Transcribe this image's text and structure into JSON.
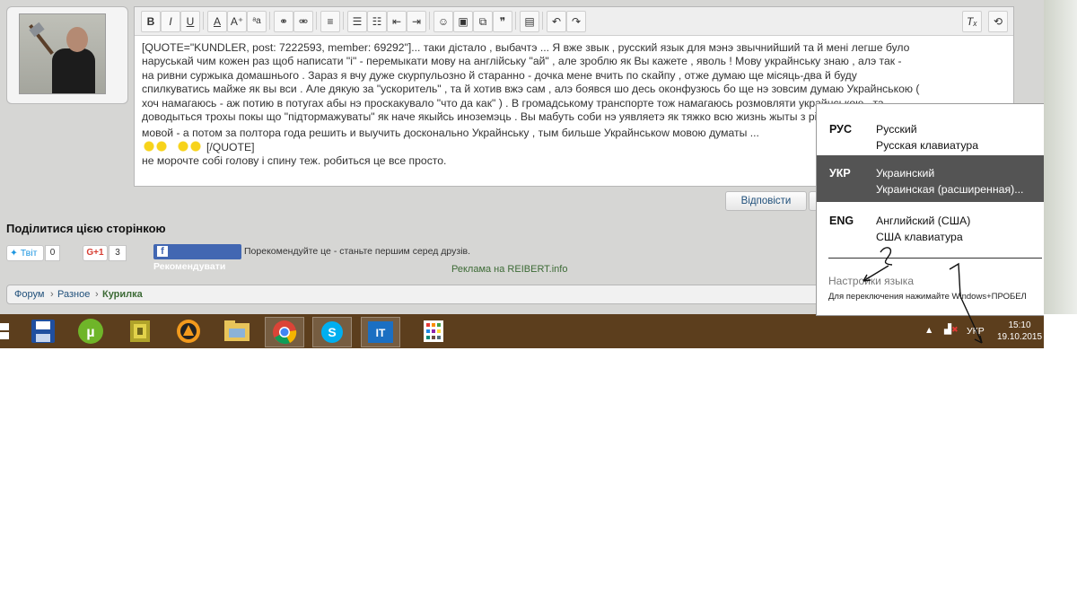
{
  "editor": {
    "lines": [
      "[QUOTE=\"KUNDLER, post: 7222593, member: 69292\"]... таки дістало , выбачтэ  ... Я вже звык , русский язык для мэнэ звычнийший  та й мені легше було",
      "наруськай чим кожен раз щоб написати  \"і\" - перемыкати мову на англійську \"ай\" , але зроблю як Вы кажете , яволь ! Мову украйнськy знаю , алэ так -",
      "на ривни суржыка домашнього .  Зараз я  вчу дуже скурпульозно й старанно - дочка мене вчить по скайпу , отже думаю ще місяць-два й буду",
      "спилкуватись майже як вы вси . Але дякую за \"ускоритель\" , та й хотив вжэ сам , алэ боявся шо десь оконфузюсь бо ще нэ зовсим думаю Украйнською (",
      "хоч намагаюсь - аж потию в потугах абы нэ проскакувало \"что да как\" ) . В громадському транспорте тож намагаюсь розмовляти украйнською , та",
      "доводыться трохы покы що \"підтормажуваты\"  як наче якыйсь иноземэць . Вы мабуть соби нэ уявляетэ як тяжко всю жизнь жыты з рiдною росийськой",
      "мовой - а потом за полтора года решить и выучить досконально Украйнську , тым бильше Украйнськow мовою думаты ..."
    ],
    "quote_end": "[/QUOTE]",
    "reply_line": "не морочте собі голову і спину теж. робиться це все просто."
  },
  "buttons": {
    "reply": "Відповісти"
  },
  "share": {
    "title": "Поділитися цією сторінкою",
    "tweet": "Твіт",
    "tweet_count": "0",
    "gplus": "G+1",
    "gplus_count": "3",
    "fb_button": "Рекомендувати",
    "fb_note": "Порекомендуйте це - станьте першим серед друзів."
  },
  "ad": "Реклама на REIBERT.info",
  "breadcrumb": {
    "forum": "Форум",
    "sep1": "›",
    "misc": "Разное",
    "sep2": "›",
    "current": "Курилка"
  },
  "language_popup": {
    "items": [
      {
        "code": "РУС",
        "name": "Русский",
        "layout": "Русская клавиатура",
        "selected": false
      },
      {
        "code": "УКР",
        "name": "Украинский",
        "layout": "Украинская (расширенная)...",
        "selected": true
      },
      {
        "code": "ENG",
        "name": "Английский (США)",
        "layout": "США клавиатура",
        "selected": false
      }
    ],
    "settings_link": "Настройки языка",
    "hint": "Для переключения нажимайте Windows+ПРОБЕЛ",
    "annotation_1": "1",
    "annotation_2": "2"
  },
  "taskbar": {
    "lang_indicator": "УКР",
    "time": "15:10",
    "date": "19.10.2015",
    "pinned": [
      "save-icon",
      "utorrent-icon",
      "game-icon",
      "aimp-icon",
      "explorer-icon",
      "chrome-icon",
      "skype-icon",
      "it-icon",
      "apps-icon"
    ]
  },
  "colors": {
    "taskbar": "#5c3e1d",
    "popup_selected": "#545454",
    "link": "#1f4f7a",
    "facebook": "#4267b2"
  }
}
